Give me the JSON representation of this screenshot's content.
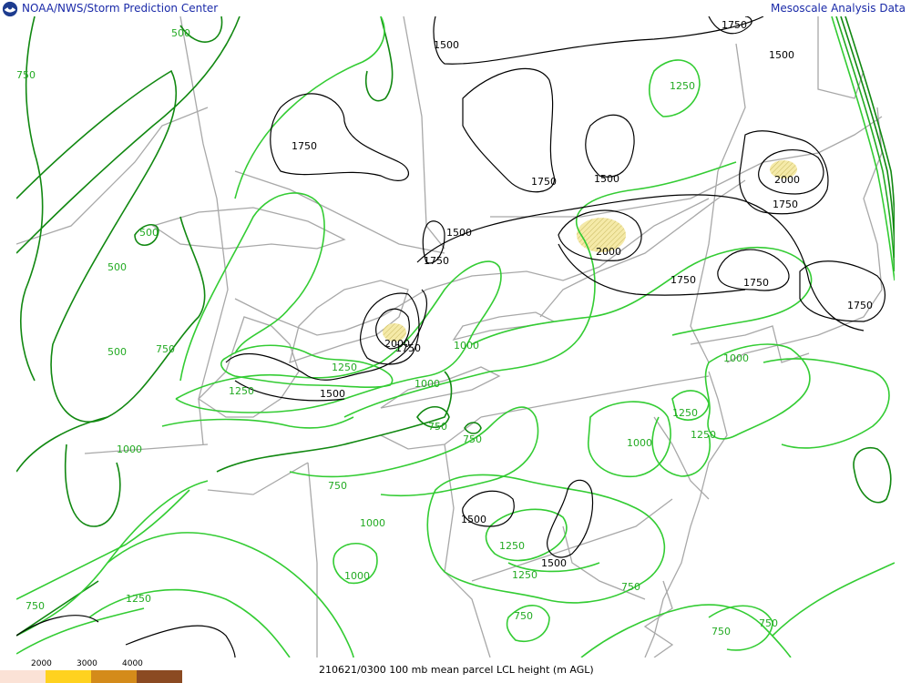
{
  "header": {
    "left_title": "NOAA/NWS/Storm Prediction Center",
    "right_title": "Mesoscale Analysis Data",
    "logo_icon": "noaa-logo-icon"
  },
  "legend": {
    "values": [
      "2000",
      "3000",
      "4000"
    ],
    "colors": [
      "#fbe2d6",
      "#ffd21f",
      "#d48b1a",
      "#8b4a22"
    ]
  },
  "caption": "210621/0300 100 mb mean parcel LCL height (m AGL)",
  "contour_labels": {
    "black": [
      "1500",
      "1750",
      "1750",
      "1500",
      "1750",
      "1750",
      "1500",
      "1750",
      "1750",
      "1750",
      "2000",
      "1750",
      "1500",
      "1750",
      "2000",
      "2000",
      "1750",
      "1500",
      "1500",
      "1500"
    ],
    "green": [
      "500",
      "750",
      "500",
      "500",
      "500",
      "750",
      "1250",
      "1250",
      "1250",
      "1250",
      "1000",
      "1000",
      "750",
      "750",
      "1000",
      "1000",
      "1000",
      "1250",
      "1250",
      "750",
      "1000",
      "1000",
      "1250",
      "1250",
      "1250",
      "750",
      "750",
      "750",
      "750",
      "750"
    ]
  },
  "colors": {
    "background": "#ffffff",
    "boundary": "#a0a0a0",
    "contour_black": "#000000",
    "contour_green_light": "#33cc33",
    "contour_green_dark": "#118811",
    "label_green": "#22aa22",
    "shade_2000": "#f0e6a6"
  }
}
